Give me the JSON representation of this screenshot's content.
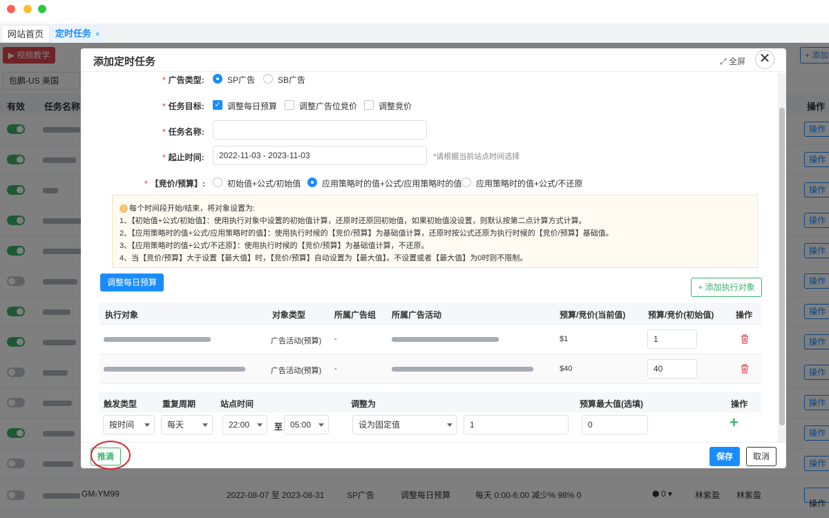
{
  "tabs": {
    "home": "网站首页",
    "task": "定时任务",
    "close": "×"
  },
  "background": {
    "video_btn": "视频教学",
    "add_btn": "添加",
    "store": "包鹏-US 美国",
    "columns": {
      "enabled": "有效",
      "name": "任务名称",
      "op": "操作"
    },
    "op_label": "操作",
    "rows": [
      {
        "on": true
      },
      {
        "on": true
      },
      {
        "on": true
      },
      {
        "on": true
      },
      {
        "on": true
      },
      {
        "on": false
      },
      {
        "on": true
      },
      {
        "on": true
      },
      {
        "on": false
      },
      {
        "on": false
      },
      {
        "on": true
      },
      {
        "on": false
      }
    ],
    "last_row": {
      "name": "GM-YM99",
      "date": "2022-08-07 至 2023-08-31",
      "type": "SP广告",
      "goal": "调整每日预算",
      "rule": "每天 0:00-6:00 减少% 98% 0",
      "count": "0",
      "creator": "林紫盈",
      "modifier": "林紫盈"
    }
  },
  "modal": {
    "title": "添加定时任务",
    "fullscreen": "全屏",
    "close": "✕",
    "ad_type": {
      "label": "广告类型:",
      "options": [
        "SP广告",
        "SB广告"
      ],
      "selected": "SP广告"
    },
    "task_goal": {
      "label": "任务目标:",
      "options": [
        "调整每日预算",
        "调整广告位竞价",
        "调整竞价"
      ],
      "checked": "调整每日预算"
    },
    "task_name": {
      "label": "任务名称:",
      "value": ""
    },
    "date_range": {
      "label": "起止时间:",
      "value": "2022-11-03 - 2023-11-03",
      "hint": "*请根据当前站点时间选择"
    },
    "bid_budget": {
      "label": "【竞价/预算】:",
      "options": [
        "初始值+公式/初始值",
        "应用策略时的值+公式/应用策略时的值",
        "应用策略时的值+公式/不还原"
      ],
      "selected": "应用策略时的值+公式/应用策略时的值"
    },
    "notice": [
      "每个时间段开始/结束，将对象设置为:",
      "1、【初始值+公式/初始值】：使用执行对象中设置的初始值计算，还原时还原回初始值，如果初始值没设置，则默认按第二点计算方式计算。",
      "2、【应用策略时的值+公式/应用策略时的值】：使用执行时候的【竞价/预算】为基础值计算，还原时按公式还原为执行时候的【竞价/预算】基础值。",
      "3、【应用策略时的值+公式/不还原】：使用执行时候的【竞价/预算】为基础值计算，不还原。",
      "4、当【竞价/预算】大于设置【最大值】时，【竞价/预算】自动设置为【最大值】。不设置或者【最大值】为0时则不限制。"
    ],
    "adjust_btn": "调整每日预算",
    "add_target_btn": "添加执行对象",
    "targets_table": {
      "columns": [
        "执行对象",
        "对象类型",
        "所属广告组",
        "所属广告活动",
        "预算/竞价(当前值)",
        "预算/竞价(初始值)",
        "操作"
      ],
      "rows": [
        {
          "type": "广告活动(预算)",
          "group": "-",
          "current": "$1",
          "initial": "1"
        },
        {
          "type": "广告活动(预算)",
          "group": "-",
          "current": "$40",
          "initial": "40"
        }
      ]
    },
    "trigger_table": {
      "columns": [
        "触发类型",
        "重复周期",
        "站点时间",
        "调整为",
        "预算最大值(选填)",
        "操作"
      ],
      "row": {
        "trigger": "按时间",
        "cycle": "每天",
        "start": "22:00",
        "to": "至",
        "end": "05:00",
        "adjust_mode": "设为固定值",
        "adjust_value": "1",
        "max": "0",
        "add": "+"
      }
    },
    "footer": {
      "push": "推滴",
      "save": "保存",
      "cancel": "取消"
    }
  },
  "colors": {
    "accent": "#1a8cff",
    "success": "#36b56a",
    "danger": "#e0474c",
    "required": "#f56c6c"
  }
}
